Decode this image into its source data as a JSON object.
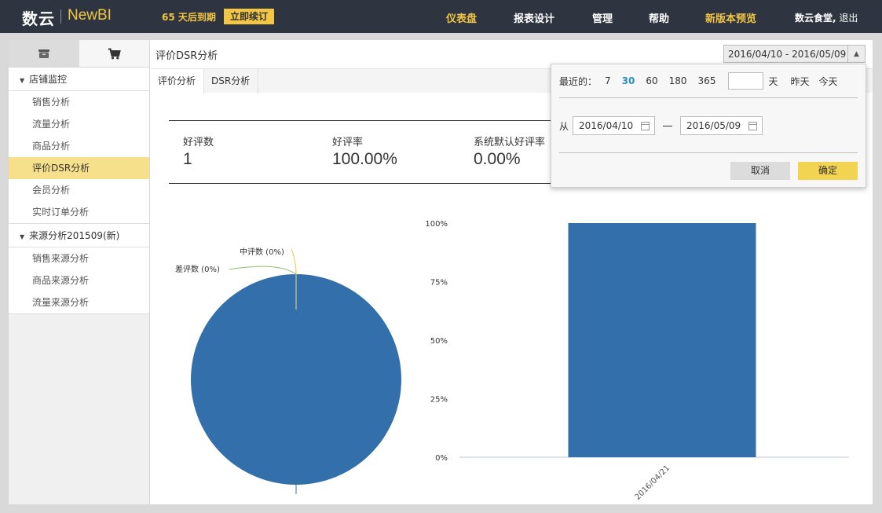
{
  "header": {
    "logo_cn": "数云",
    "logo_en": "NewBI",
    "expire_text": "65 天后到期",
    "renew_label": "立即续订",
    "nav": [
      "仪表盘",
      "报表设计",
      "管理",
      "帮助",
      "新版本预览"
    ],
    "user_name": "数云食堂,",
    "logout_label": "退出",
    "colors": {
      "bar_bg": "#2e3440",
      "accent": "#f3c744"
    }
  },
  "sidebar": {
    "tab_icons": [
      "inbox-icon",
      "cart-icon"
    ],
    "groups": [
      {
        "label": "店铺监控",
        "items": [
          "销售分析",
          "流量分析",
          "商品分析",
          "评价DSR分析",
          "会员分析",
          "实时订单分析"
        ],
        "active_index": 3
      },
      {
        "label": "来源分析201509(新)",
        "items": [
          "销售来源分析",
          "商品来源分析",
          "流量来源分析"
        ]
      }
    ]
  },
  "main": {
    "title": "评价DSR分析",
    "date_range": "2016/04/10 - 2016/05/09",
    "tabs": [
      "评价分析",
      "DSR分析"
    ],
    "active_tab": 0,
    "kpis": [
      {
        "label": "好评数",
        "value": "1"
      },
      {
        "label": "好评率",
        "value": "100.00%"
      },
      {
        "label": "系统默认好评率",
        "value": "0.00%"
      }
    ]
  },
  "date_picker": {
    "recent_label": "最近的：",
    "options": [
      "7",
      "30",
      "60",
      "180",
      "365"
    ],
    "active_option": "30",
    "days_value": "",
    "unit_label": "天",
    "yesterday_label": "昨天",
    "today_label": "今天",
    "from_label": "从",
    "start_date": "2016/04/10",
    "end_date": "2016/05/09",
    "cancel_label": "取消",
    "ok_label": "确定"
  },
  "chart_data": [
    {
      "type": "pie",
      "labels": [
        "好评数",
        "中评数",
        "差评数"
      ],
      "values": [
        100,
        0,
        0
      ],
      "visible_labels": [
        "中评数 (0%)",
        "差评数 (0%)"
      ],
      "colors": [
        "#336faa",
        "#e3c84a",
        "#8ec06c"
      ]
    },
    {
      "type": "bar",
      "categories": [
        "2016/04/21"
      ],
      "values": [
        100
      ],
      "ylim": [
        0,
        100
      ],
      "yticks": [
        "0%",
        "25%",
        "50%",
        "75%",
        "100%"
      ],
      "colors": [
        "#336faa"
      ]
    }
  ]
}
